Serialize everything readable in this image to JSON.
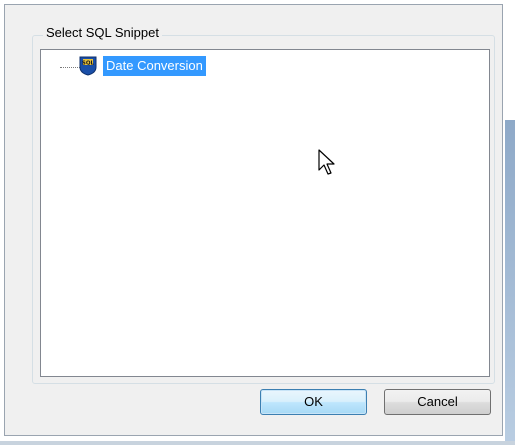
{
  "dialog": {
    "group_title": "Select SQL Snippet",
    "tree": {
      "nodes": [
        {
          "label": "Date Conversion",
          "selected": true,
          "icon": "sql-snippet-icon"
        }
      ]
    },
    "buttons": {
      "ok_label": "OK",
      "cancel_label": "Cancel"
    }
  },
  "colors": {
    "selection": "#3399ff",
    "dialog_bg": "#f0f0f0",
    "ok_button_border": "#3c7fb1"
  }
}
